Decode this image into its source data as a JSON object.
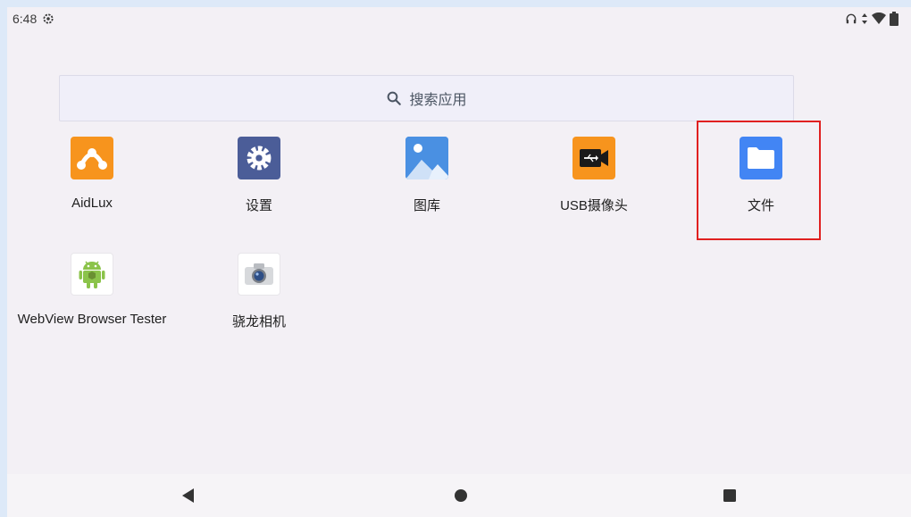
{
  "status": {
    "time": "6:48",
    "left_icons": [
      "settings-gear-icon"
    ],
    "right_icons": [
      "headphones-icon",
      "data-arrows-icon",
      "wifi-icon",
      "battery-icon"
    ]
  },
  "search": {
    "label": "搜索应用",
    "icon": "search-icon"
  },
  "apps": [
    {
      "label": "AidLux",
      "icon": "aidlux-icon",
      "color": "#f7941d"
    },
    {
      "label": "设置",
      "icon": "settings-icon",
      "color": "#4b5d98"
    },
    {
      "label": "图库",
      "icon": "gallery-icon",
      "color": "#4a90e2"
    },
    {
      "label": "USB摄像头",
      "icon": "usb-camera-icon",
      "color": "#f7941d"
    },
    {
      "label": "文件",
      "icon": "files-folder-icon",
      "color": "#4285f4"
    },
    {
      "label": "WebView Browser Tester",
      "icon": "android-icon",
      "color": "#8bc34a"
    },
    {
      "label": "骁龙相机",
      "icon": "camera-icon",
      "color": "#3a5b8c"
    }
  ],
  "nav": {
    "back": "back-triangle-icon",
    "home": "home-circle-icon",
    "recents": "recents-square-icon"
  },
  "highlight_color": "#e02020"
}
